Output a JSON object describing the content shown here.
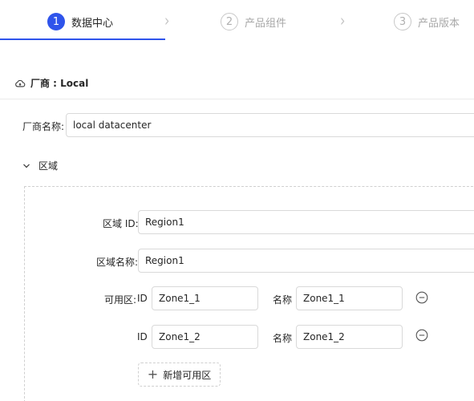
{
  "steps": [
    {
      "number": "1",
      "label": "数据中心",
      "state": "active"
    },
    {
      "number": "2",
      "label": "产品组件",
      "state": "inactive"
    },
    {
      "number": "3",
      "label": "产品版本",
      "state": "inactive"
    }
  ],
  "vendor": {
    "title": "厂商 : Local",
    "icon": "cloud-icon",
    "name_label": "厂商名称:",
    "name_value": "local datacenter"
  },
  "region_section": {
    "title": "区域",
    "icon": "chevron-down-icon",
    "region_id_label": "区域 ID:",
    "region_id_value": "Region1",
    "region_name_label": "区域名称:",
    "region_name_value": "Region1",
    "zones_label": "可用区:",
    "zones": [
      {
        "id_label": "ID",
        "id_value": "Zone1_1",
        "name_label": "名称",
        "name_value": "Zone1_1"
      },
      {
        "id_label": "ID",
        "id_value": "Zone1_2",
        "name_label": "名称",
        "name_value": "Zone1_2"
      }
    ],
    "add_zone_label": "新增可用区"
  },
  "colors": {
    "accent": "#2f54eb",
    "border": "#d9d9d9"
  }
}
